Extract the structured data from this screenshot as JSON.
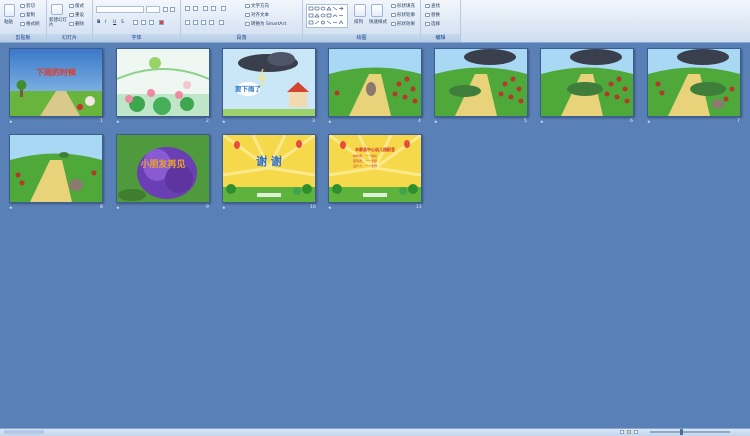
{
  "ribbon": {
    "groups": [
      {
        "label": "剪贴板",
        "buttons": [
          "粘贴",
          "剪切",
          "复制",
          "格式刷"
        ]
      },
      {
        "label": "幻灯片",
        "buttons": [
          "新建幻灯片",
          "版式",
          "重设",
          "删除"
        ]
      },
      {
        "label": "字体",
        "buttons": [
          "B",
          "I",
          "U",
          "S"
        ]
      },
      {
        "label": "段落",
        "buttons": [
          "文字方向",
          "对齐文本",
          "转换为 SmartArt"
        ]
      },
      {
        "label": "绘图",
        "buttons": [
          "排列",
          "快速样式",
          "形状填充",
          "形状轮廓",
          "形状效果"
        ]
      },
      {
        "label": "编辑",
        "buttons": [
          "查找",
          "替换",
          "选择"
        ]
      }
    ]
  },
  "slides": [
    {
      "number": "1",
      "title": "下雨的时候"
    },
    {
      "number": "2",
      "title": ""
    },
    {
      "number": "3",
      "title": "要下雨了"
    },
    {
      "number": "4",
      "title": ""
    },
    {
      "number": "5",
      "title": ""
    },
    {
      "number": "6",
      "title": ""
    },
    {
      "number": "7",
      "title": ""
    },
    {
      "number": "8",
      "title": ""
    },
    {
      "number": "9",
      "title": "小朋友再见"
    },
    {
      "number": "10",
      "title": "谢 谢"
    },
    {
      "number": "11",
      "title": "丰都县中心幼儿园配音",
      "lines": [
        "制作者：一一鼠标",
        "配音者：一一老师",
        "设计人：一一老师"
      ]
    }
  ],
  "colors": {
    "workspace": "#5a81b7",
    "ribbon": "#dfe9f5"
  }
}
